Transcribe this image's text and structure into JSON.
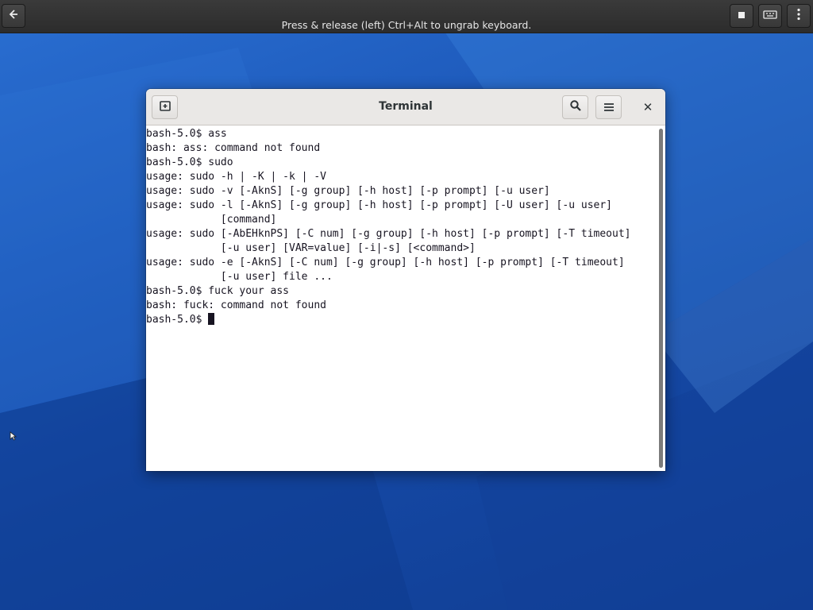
{
  "vm_bar": {
    "message": "Press & release (left) Ctrl+Alt to ungrab keyboard.",
    "back_icon": "back-arrow-icon",
    "stop_icon": "stop-icon",
    "keyboard_icon": "keyboard-icon",
    "menu_icon": "vertical-dots-icon"
  },
  "window": {
    "title": "Terminal",
    "new_tab_icon": "new-tab-icon",
    "search_icon": "search-icon",
    "menu_icon": "hamburger-menu-icon",
    "close_glyph": "✕"
  },
  "terminal": {
    "lines": [
      "bash-5.0$ ass",
      "bash: ass: command not found",
      "bash-5.0$ sudo",
      "usage: sudo -h | -K | -k | -V",
      "usage: sudo -v [-AknS] [-g group] [-h host] [-p prompt] [-u user]",
      "usage: sudo -l [-AknS] [-g group] [-h host] [-p prompt] [-U user] [-u user]",
      "            [command]",
      "usage: sudo [-AbEHknPS] [-C num] [-g group] [-h host] [-p prompt] [-T timeout]",
      "            [-u user] [VAR=value] [-i|-s] [<command>]",
      "usage: sudo -e [-AknS] [-C num] [-g group] [-h host] [-p prompt] [-T timeout]",
      "            [-u user] file ...",
      "bash-5.0$ fuck your ass",
      "bash: fuck: command not found"
    ],
    "prompt": "bash-5.0$ "
  },
  "colors": {
    "wallpaper": "#1c57b8",
    "vm_bar": "#2f2f2f",
    "headerbar": "#eae8e6",
    "terminal_bg": "#ffffff",
    "terminal_fg": "#171421"
  }
}
